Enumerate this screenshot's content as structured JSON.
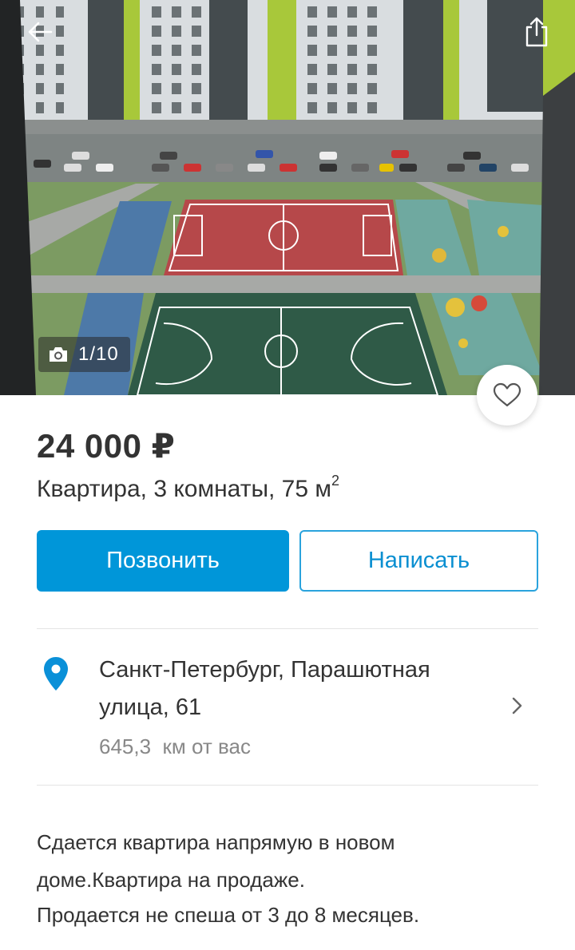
{
  "gallery": {
    "counter": "1/10",
    "camera_icon": "camera-icon",
    "back_icon": "arrow-left-icon",
    "share_icon": "share-icon",
    "favorite_icon": "heart-outline-icon"
  },
  "listing": {
    "price": "24 000 ₽",
    "title": "Квартира, 3 комнаты, 75 м",
    "title_unit_sup": "2"
  },
  "actions": {
    "call_label": "Позвонить",
    "write_label": "Написать"
  },
  "location": {
    "address_line1": "Санкт-Петербург, Парашютная",
    "address_line2": "улица, 61",
    "distance": "645,3  км от вас",
    "pin_icon": "map-pin-icon",
    "chevron_icon": "chevron-right-icon"
  },
  "description": {
    "line1": "Сдается квартира напрямую в новом",
    "line2": "доме.Квартира на продаже.",
    "line3": "Продается не спеша от 3 до 8 месяцев."
  },
  "colors": {
    "accent": "#0096d9",
    "pin": "#0a90d8",
    "text": "#333333",
    "muted": "#888888"
  }
}
